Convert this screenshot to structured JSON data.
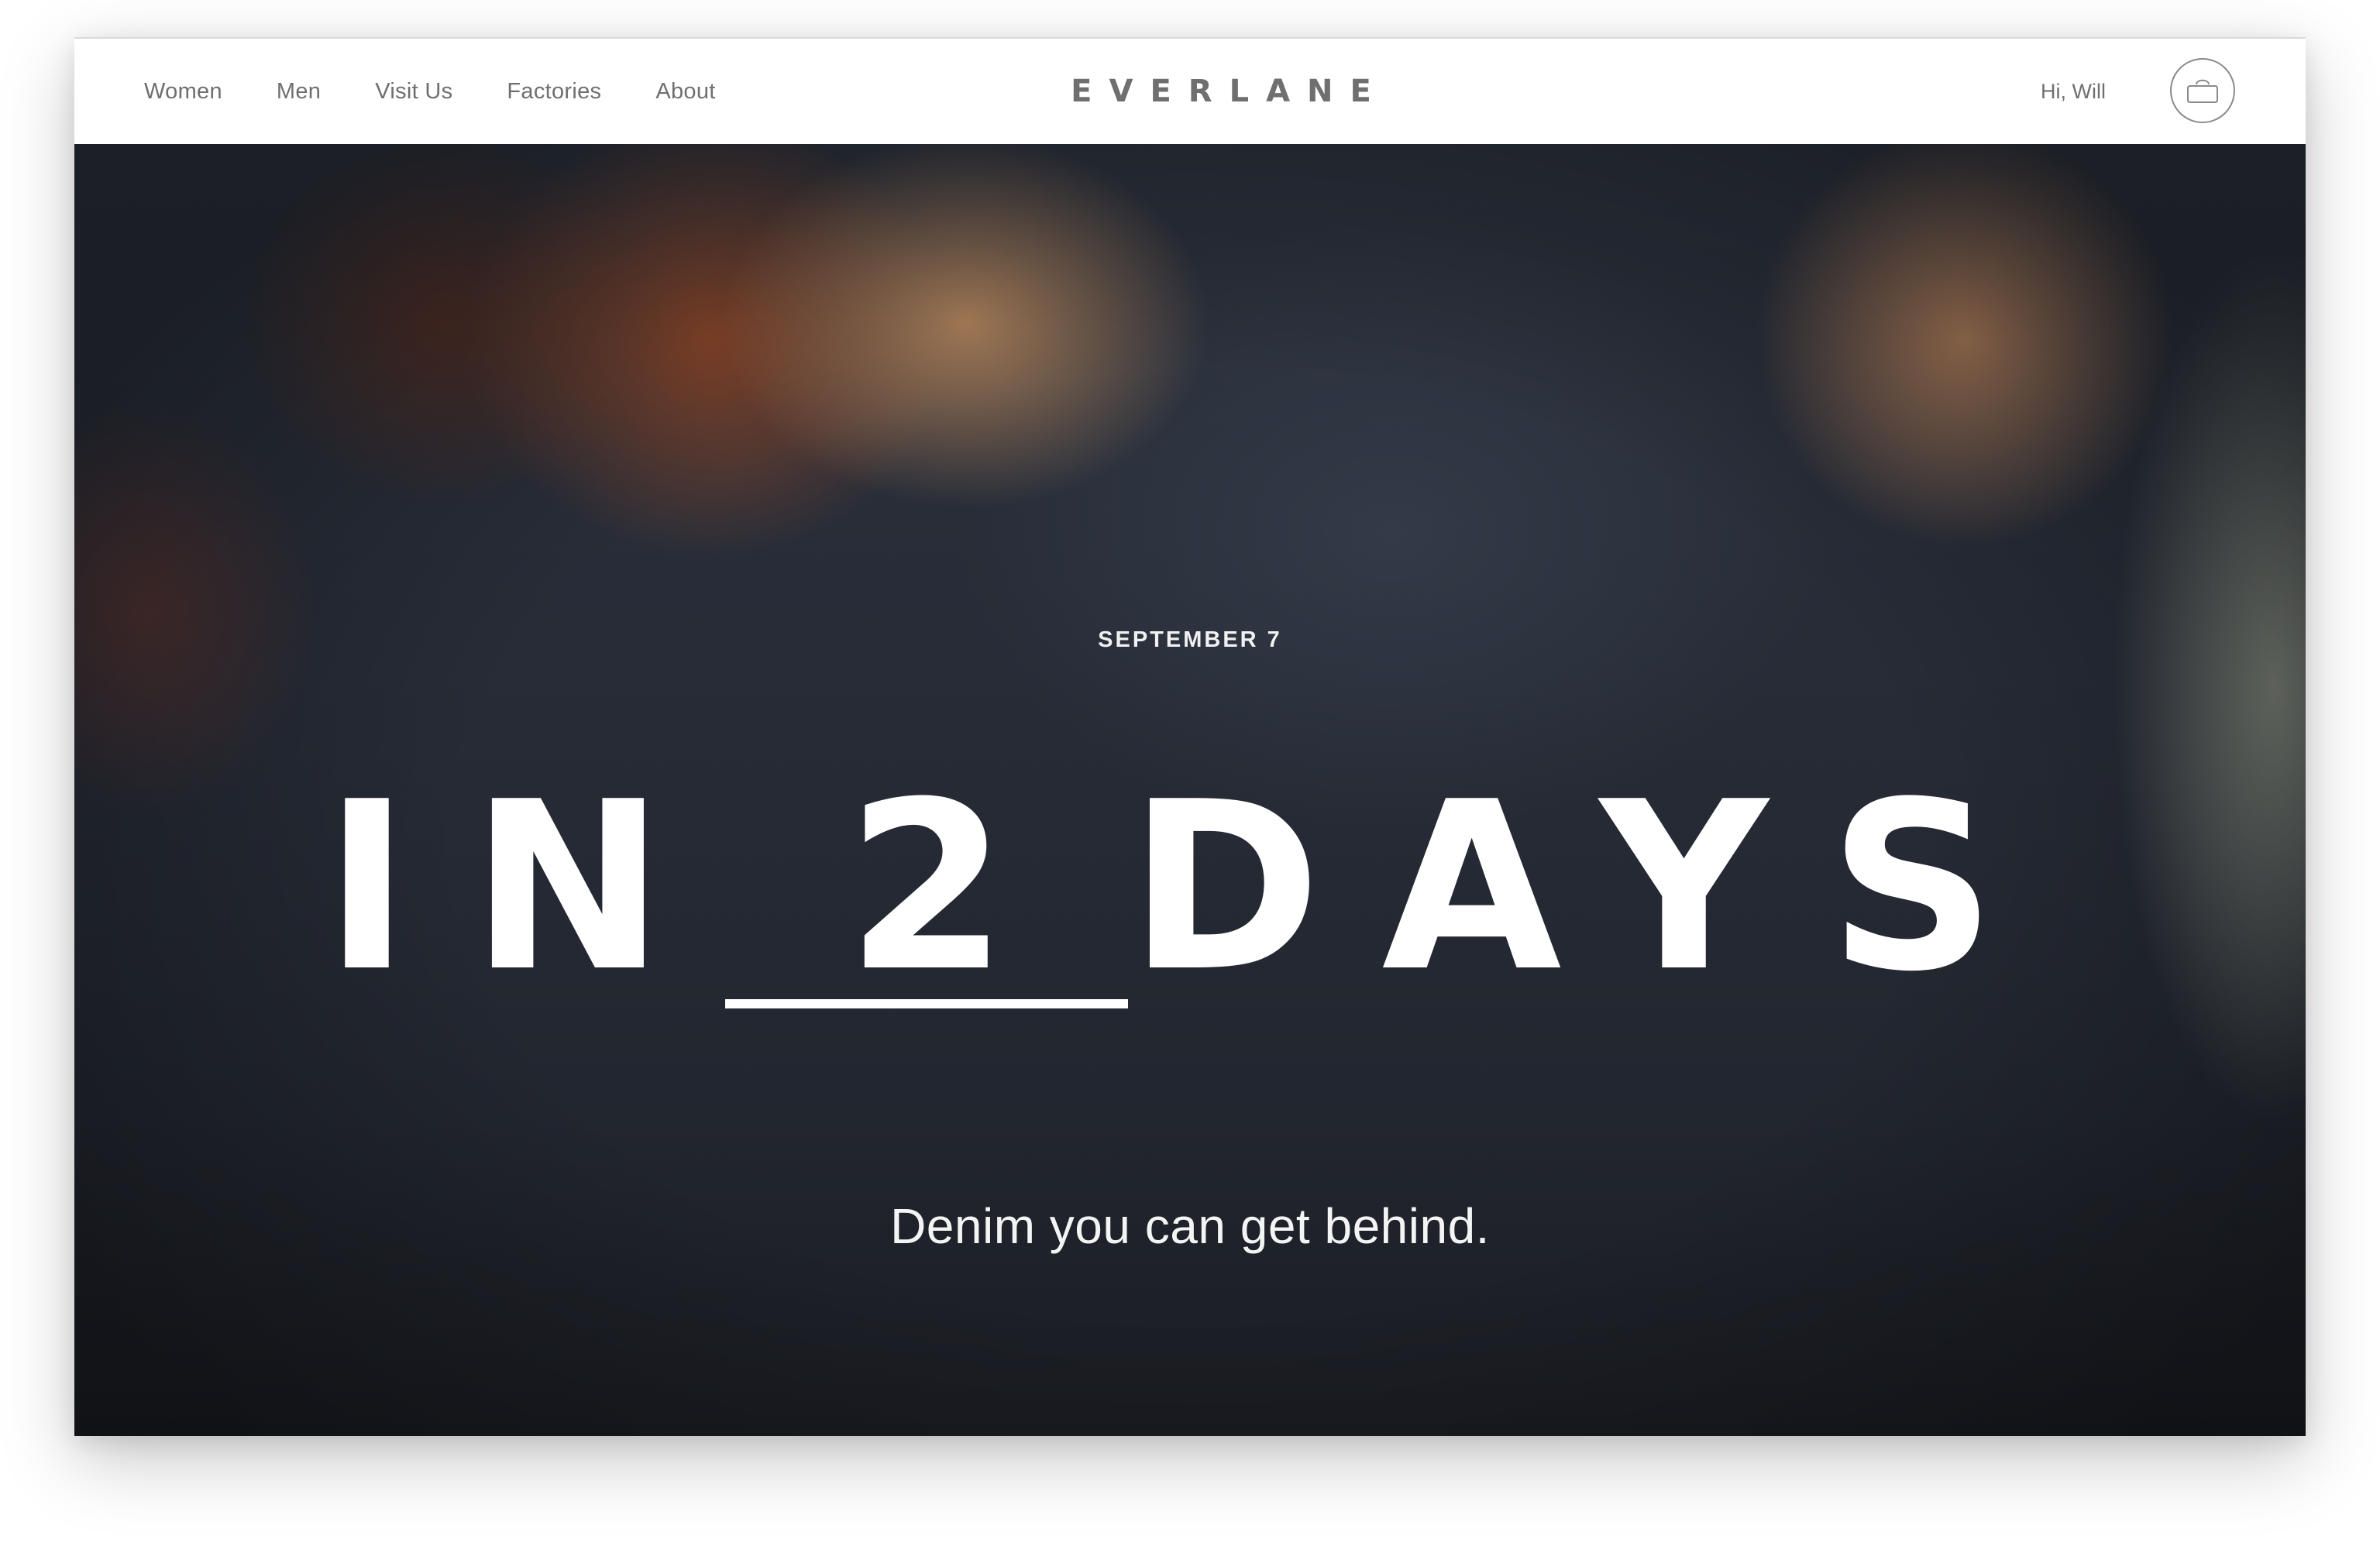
{
  "nav": {
    "items": [
      {
        "label": "Women"
      },
      {
        "label": "Men"
      },
      {
        "label": "Visit Us"
      },
      {
        "label": "Factories"
      },
      {
        "label": "About"
      }
    ]
  },
  "brand": {
    "logo_text": "EVERLANE"
  },
  "account": {
    "greeting": "Hi, Will",
    "cart_icon": "bag-icon"
  },
  "hero": {
    "date": "SEPTEMBER 7",
    "prefix": "IN",
    "count": "2",
    "unit": "DAYS",
    "tagline": "Denim you can get behind."
  },
  "colors": {
    "nav_text": "#6f6f6f",
    "hero_text": "#ffffff",
    "hero_background": "#272c37"
  }
}
